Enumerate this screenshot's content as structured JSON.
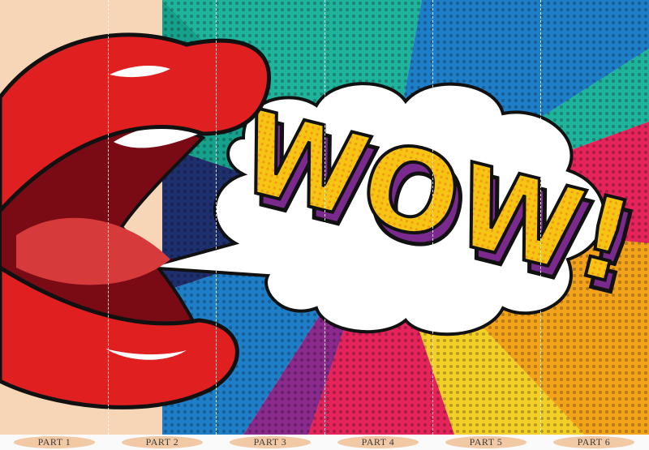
{
  "artwork": {
    "exclamation": "WOW!",
    "colors": {
      "background_skin": "#f6d6b6",
      "lips_red": "#e02020",
      "lips_highlight": "#ffffff",
      "mouth_dark": "#7a0a14",
      "tongue": "#d63a3a",
      "ray_teal": "#1fb39c",
      "ray_blue": "#1f7ec8",
      "ray_navy": "#1e2f6e",
      "ray_pink": "#e5245c",
      "ray_orange": "#f3a21c",
      "ray_yellow": "#f4cf28",
      "ray_purple": "#8a2a8c",
      "text_yellow": "#f6c514",
      "text_shadow_purple": "#7a2a8c",
      "outline": "#111111"
    }
  },
  "panels": [
    {
      "label": "PART 1"
    },
    {
      "label": "PART 2"
    },
    {
      "label": "PART 3"
    },
    {
      "label": "PART 4"
    },
    {
      "label": "PART 5"
    },
    {
      "label": "PART 6"
    }
  ]
}
